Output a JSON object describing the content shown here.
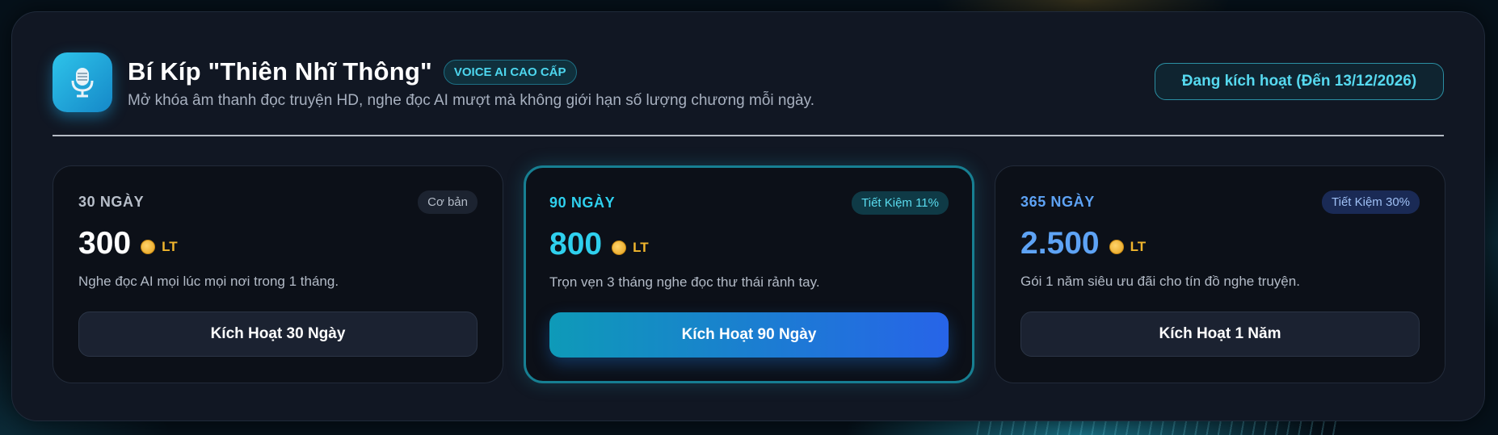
{
  "header": {
    "icon": "microphone-icon",
    "title": "Bí Kíp \"Thiên Nhĩ Thông\"",
    "badge": "VOICE AI CAO CẤP",
    "subtitle": "Mở khóa âm thanh đọc truyện HD, nghe đọc AI mượt mà không giới hạn số lượng chương mỗi ngày.",
    "status": "Đang kích hoạt (Đến 13/12/2026)"
  },
  "plans": [
    {
      "days": "30 NGÀY",
      "tag": "Cơ bản",
      "price": "300",
      "currency": "LT",
      "description": "Nghe đọc AI mọi lúc mọi nơi trong 1 tháng.",
      "button": "Kích Hoạt 30 Ngày",
      "accent": "#b8bfca"
    },
    {
      "days": "90 NGÀY",
      "tag": "Tiết Kiệm 11%",
      "price": "800",
      "currency": "LT",
      "description": "Trọn vẹn 3 tháng nghe đọc thư thái rảnh tay.",
      "button": "Kích Hoạt 90 Ngày",
      "accent": "#2fd0ee"
    },
    {
      "days": "365 NGÀY",
      "tag": "Tiết Kiệm 30%",
      "price": "2.500",
      "currency": "LT",
      "description": "Gói 1 năm siêu ưu đãi cho tín đồ nghe truyện.",
      "button": "Kích Hoạt 1 Năm",
      "accent": "#5ea3f5"
    }
  ],
  "colors": {
    "coin": "#f0b52d",
    "featured_border": "#177f92",
    "cta_gradient_start": "#0e9ab8",
    "cta_gradient_end": "#2764e8"
  }
}
